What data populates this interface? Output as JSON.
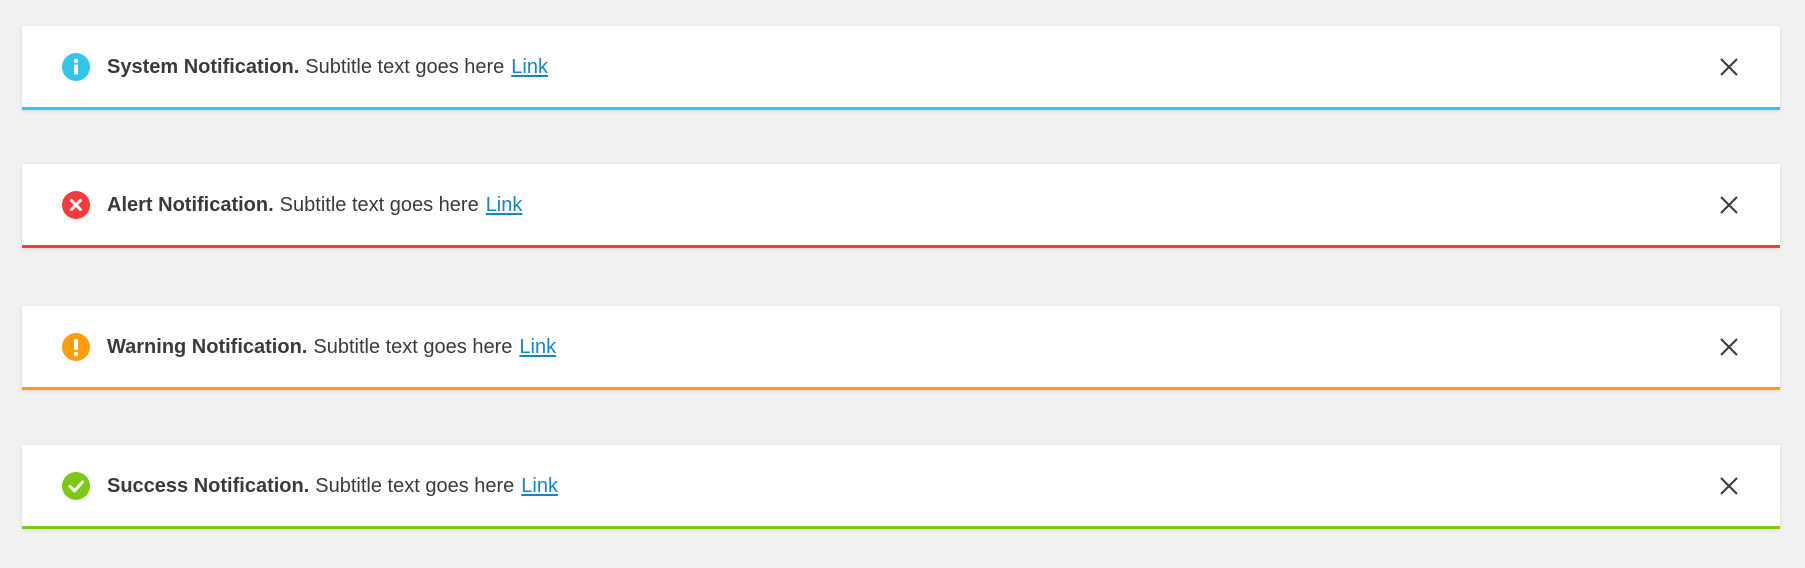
{
  "notifications": [
    {
      "type": "info",
      "title": "System Notification.",
      "subtitle": "Subtitle text goes here",
      "link": "Link",
      "icon": "info-icon",
      "color": "#33c4ea"
    },
    {
      "type": "alert",
      "title": "Alert Notification.",
      "subtitle": "Subtitle text goes here",
      "link": "Link",
      "icon": "error-icon",
      "color": "#f33b3b"
    },
    {
      "type": "warning",
      "title": "Warning Notification.",
      "subtitle": "Subtitle text goes here",
      "link": "Link",
      "icon": "warning-icon",
      "color": "#fd9d10"
    },
    {
      "type": "success",
      "title": "Success Notification.",
      "subtitle": "Subtitle text goes here",
      "link": "Link",
      "icon": "checkmark-icon",
      "color": "#7cc816"
    }
  ],
  "close_icon": "close-icon",
  "colors": {
    "background": "#f1f1f1",
    "text": "#3a3a3a",
    "link": "#1a83c4"
  }
}
